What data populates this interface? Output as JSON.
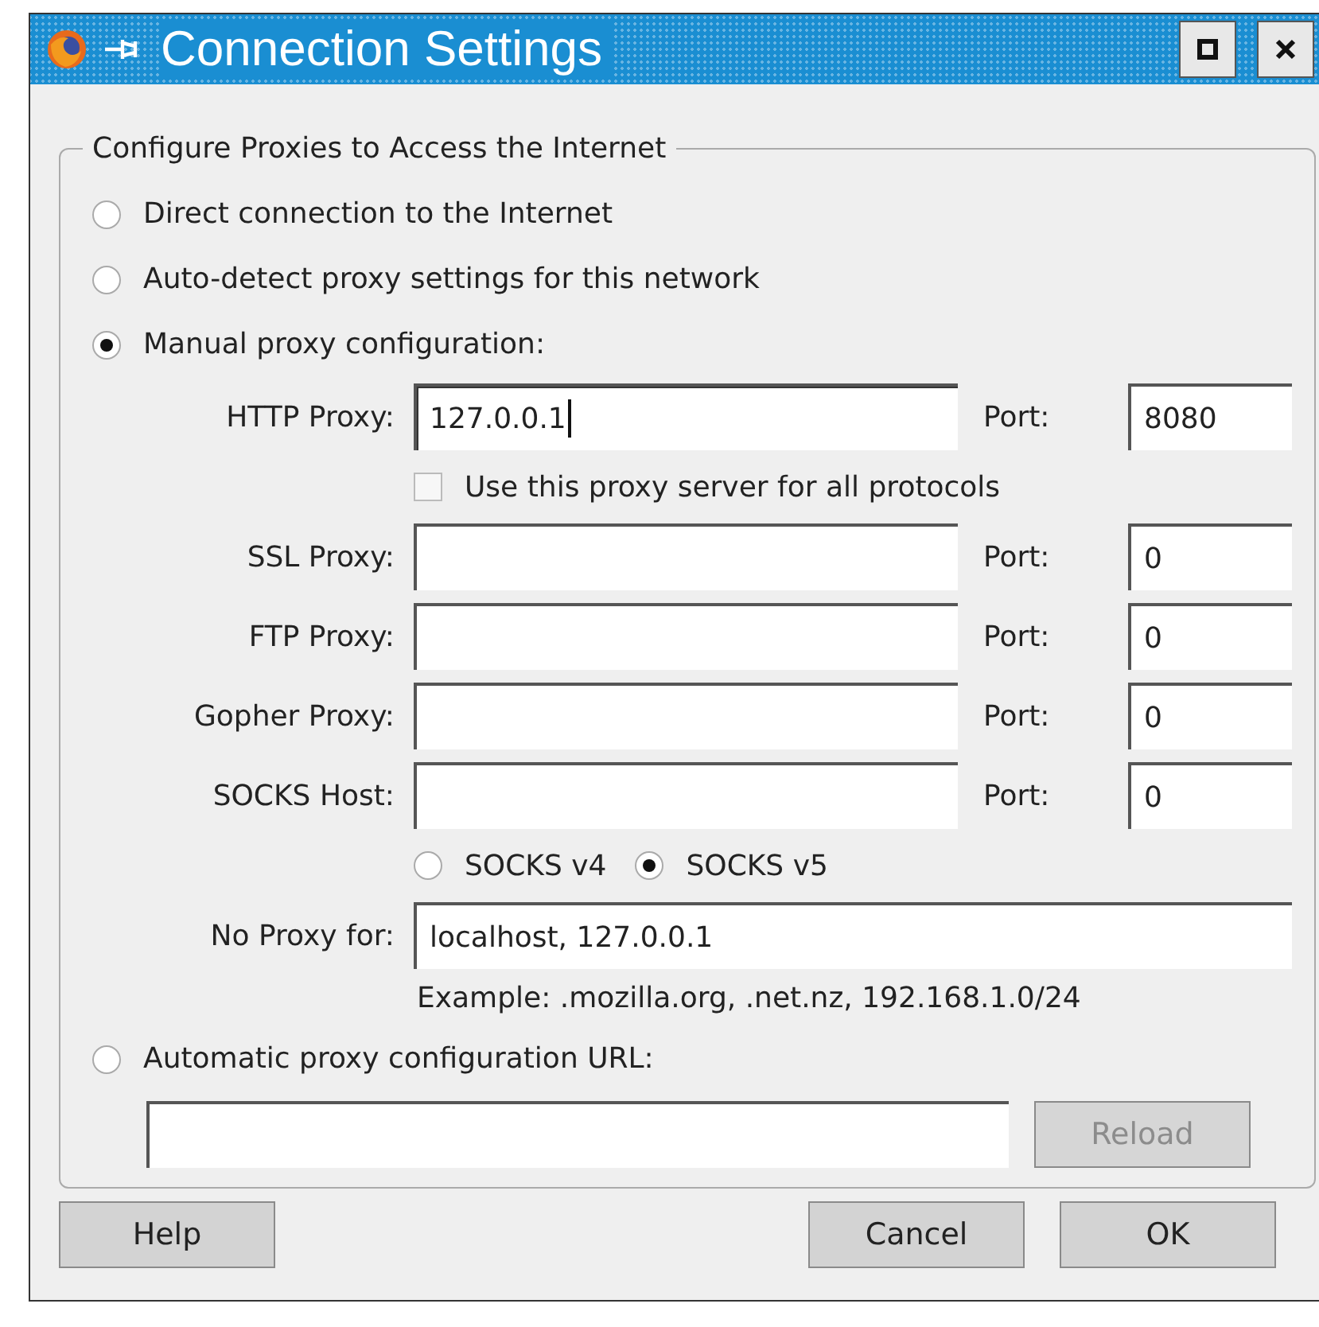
{
  "window": {
    "title": "Connection Settings"
  },
  "group": {
    "legend": "Configure Proxies to Access the Internet"
  },
  "modes": [
    {
      "label": "Direct connection to the Internet",
      "selected": false
    },
    {
      "label": "Auto-detect proxy settings for this network",
      "selected": false
    },
    {
      "label": "Manual proxy configuration:",
      "selected": true
    }
  ],
  "proxies": [
    {
      "label": "HTTP Proxy:",
      "value": "127.0.0.1",
      "focused": true,
      "port_label": "Port:",
      "port": "8080"
    },
    {
      "label": "SSL Proxy:",
      "focused": false,
      "port_label": "Port:",
      "port": "0"
    },
    {
      "label": "FTP Proxy:",
      "focused": false,
      "port_label": "Port:",
      "port": "0"
    },
    {
      "label": "Gopher Proxy:",
      "focused": false,
      "port_label": "Port:",
      "port": "0"
    },
    {
      "label": "SOCKS Host:",
      "focused": false,
      "port_label": "Port:",
      "port": "0"
    }
  ],
  "share_all": {
    "label": "Use this proxy server for all protocols",
    "checked": false
  },
  "socks_versions": [
    {
      "label": "SOCKS v4",
      "selected": false
    },
    {
      "label": "SOCKS v5",
      "selected": true
    }
  ],
  "no_proxy": {
    "label": "No Proxy for:",
    "value": "localhost, 127.0.0.1"
  },
  "example": "Example: .mozilla.org, .net.nz, 192.168.1.0/24",
  "auto_config": {
    "label": "Automatic proxy configuration URL:",
    "selected": false,
    "reload": {
      "label": "Reload",
      "disabled": true
    }
  },
  "buttons": [
    {
      "label": "Help",
      "kind": "left"
    },
    {
      "label": "Cancel",
      "kind": "right"
    },
    {
      "label": "OK",
      "kind": "right"
    }
  ]
}
